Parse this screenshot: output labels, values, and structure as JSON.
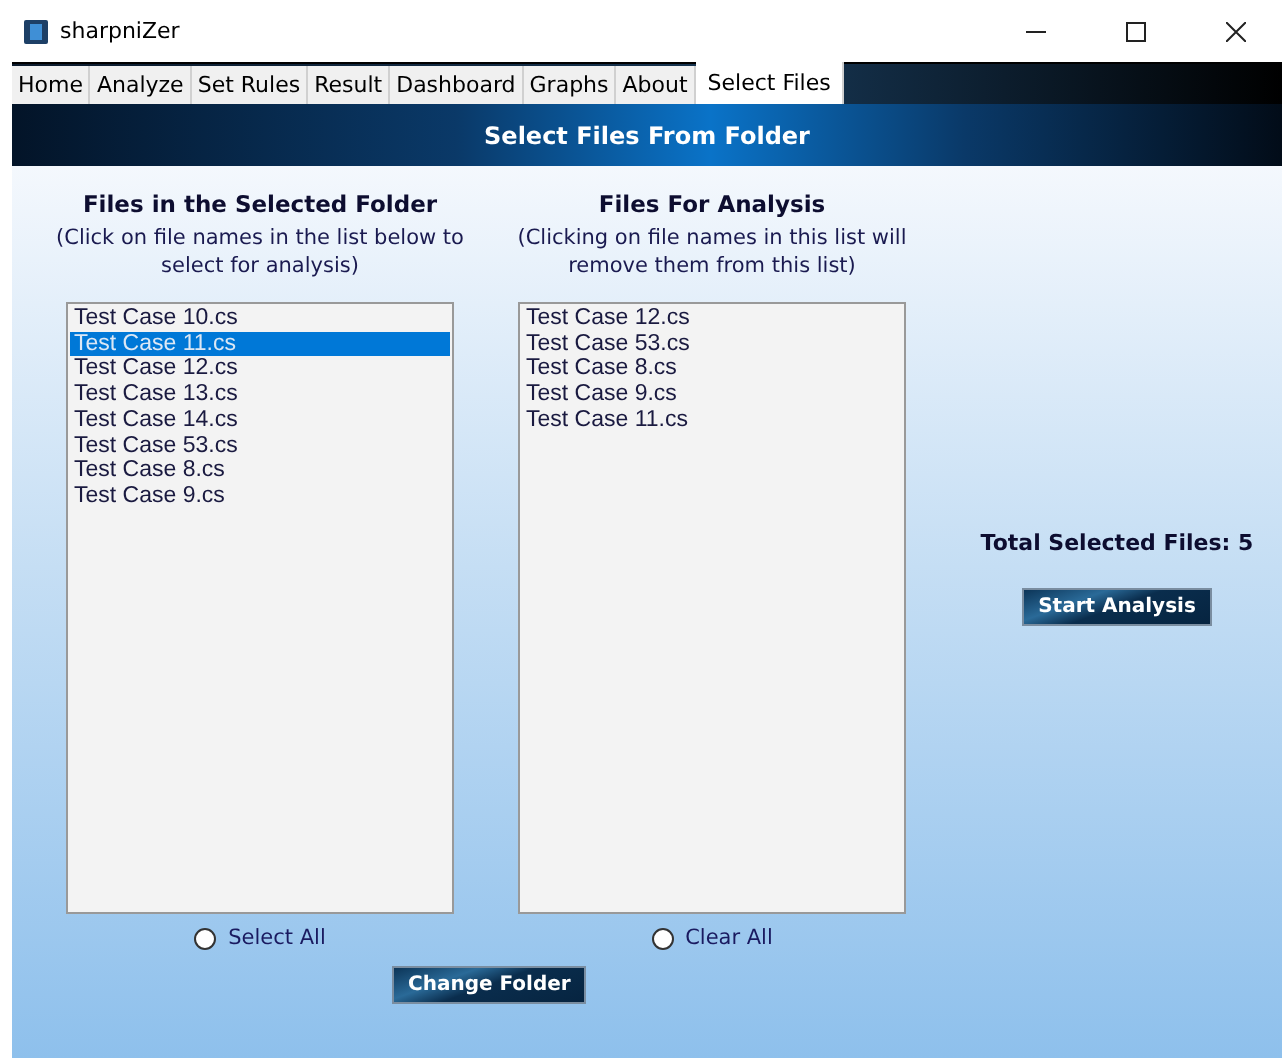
{
  "window": {
    "title": "sharpniZer"
  },
  "tabs": [
    {
      "label": "Home",
      "selected": false
    },
    {
      "label": "Analyze",
      "selected": false
    },
    {
      "label": "Set Rules",
      "selected": false
    },
    {
      "label": "Result",
      "selected": false
    },
    {
      "label": "Dashboard",
      "selected": false
    },
    {
      "label": "Graphs",
      "selected": false
    },
    {
      "label": "About",
      "selected": false
    },
    {
      "label": "Select Files",
      "selected": true
    }
  ],
  "banner": "Select Files From Folder",
  "folder_panel": {
    "heading": "Files in the Selected Folder",
    "hint": "(Click on file names in the list below to select for analysis)",
    "files": [
      {
        "name": "Test Case 10.cs",
        "selected": false
      },
      {
        "name": "Test Case 11.cs",
        "selected": true
      },
      {
        "name": "Test Case 12.cs",
        "selected": false
      },
      {
        "name": "Test Case 13.cs",
        "selected": false
      },
      {
        "name": "Test Case 14.cs",
        "selected": false
      },
      {
        "name": "Test Case 53.cs",
        "selected": false
      },
      {
        "name": "Test Case 8.cs",
        "selected": false
      },
      {
        "name": "Test Case 9.cs",
        "selected": false
      }
    ],
    "radio": {
      "label": "Select All",
      "checked": false
    }
  },
  "analysis_panel": {
    "heading": "Files For Analysis",
    "hint": "(Clicking on file names in this list will remove them from this list)",
    "files": [
      {
        "name": "Test Case 12.cs",
        "selected": false
      },
      {
        "name": "Test Case 53.cs",
        "selected": false
      },
      {
        "name": "Test Case 8.cs",
        "selected": false
      },
      {
        "name": "Test Case 9.cs",
        "selected": false
      },
      {
        "name": "Test Case 11.cs",
        "selected": false
      }
    ],
    "radio": {
      "label": "Clear All",
      "checked": false
    }
  },
  "total": "Total Selected Files: 5",
  "start_button": "Start Analysis",
  "change_button": "Change Folder"
}
